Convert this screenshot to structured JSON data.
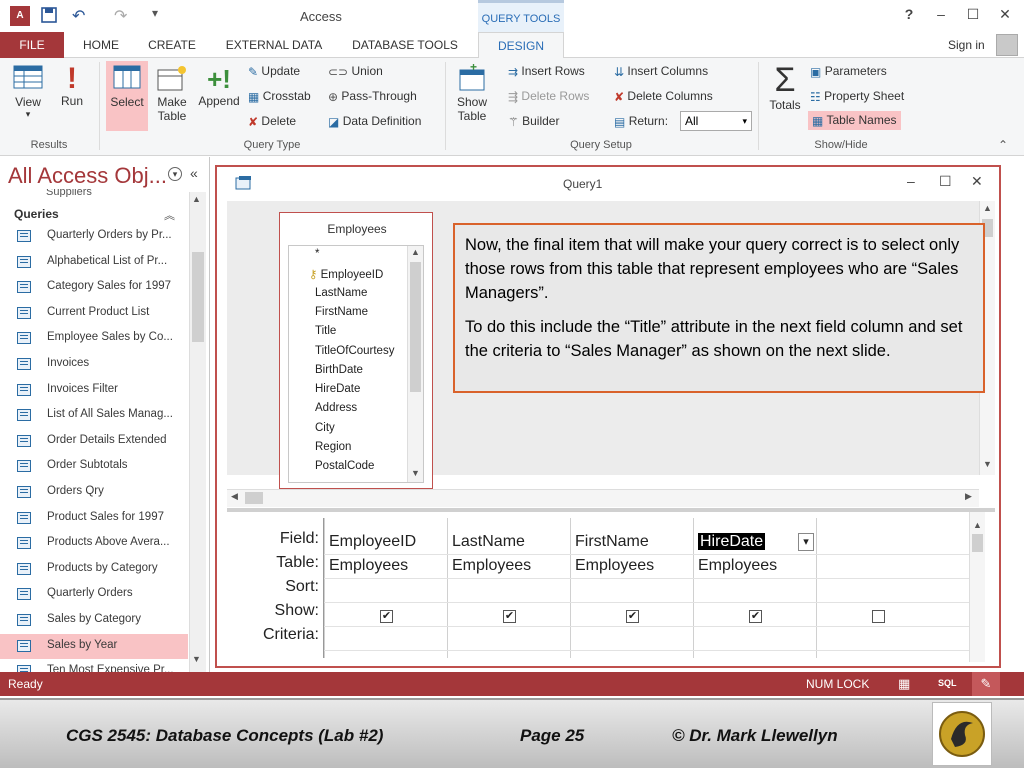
{
  "titlebar": {
    "title": "Access",
    "context_tab": "QUERY TOOLS",
    "help": "?",
    "minimize": "–",
    "maximize": "☐",
    "close": "✕"
  },
  "tabs": [
    {
      "label": "FILE"
    },
    {
      "label": "HOME"
    },
    {
      "label": "CREATE"
    },
    {
      "label": "EXTERNAL DATA"
    },
    {
      "label": "DATABASE TOOLS"
    },
    {
      "label": "DESIGN"
    }
  ],
  "signin": "Sign in",
  "ribbon": {
    "results": {
      "label": "Results",
      "view": "View",
      "run": "Run"
    },
    "query_type": {
      "label": "Query Type",
      "select": "Select",
      "make_table_1": "Make",
      "make_table_2": "Table",
      "append": "Append",
      "update": "Update",
      "crosstab": "Crosstab",
      "delete": "Delete",
      "union": "Union",
      "pass_through": "Pass-Through",
      "data_definition": "Data Definition"
    },
    "query_setup": {
      "label": "Query Setup",
      "show_table_1": "Show",
      "show_table_2": "Table",
      "insert_rows": "Insert Rows",
      "delete_rows": "Delete Rows",
      "builder": "Builder",
      "insert_columns": "Insert Columns",
      "delete_columns": "Delete Columns",
      "return_label": "Return:",
      "return_value": "All"
    },
    "show_hide": {
      "label": "Show/Hide",
      "totals": "Totals",
      "parameters": "Parameters",
      "property_sheet": "Property Sheet",
      "table_names": "Table Names"
    }
  },
  "nav": {
    "title": "All Access Obj...",
    "collapse": "«",
    "partial_top": "Suppliers",
    "section": "Queries",
    "items": [
      {
        "label": "Quarterly Orders by Pr..."
      },
      {
        "label": "Alphabetical List of Pr..."
      },
      {
        "label": "Category Sales for 1997"
      },
      {
        "label": "Current Product List"
      },
      {
        "label": "Employee Sales by Co..."
      },
      {
        "label": "Invoices"
      },
      {
        "label": "Invoices Filter"
      },
      {
        "label": "List of All Sales Manag..."
      },
      {
        "label": "Order Details Extended"
      },
      {
        "label": "Order Subtotals"
      },
      {
        "label": "Orders Qry"
      },
      {
        "label": "Product Sales for 1997"
      },
      {
        "label": "Products Above Avera..."
      },
      {
        "label": "Products by Category"
      },
      {
        "label": "Quarterly Orders"
      },
      {
        "label": "Sales by Category"
      },
      {
        "label": "Sales by Year"
      },
      {
        "label": "Ten Most Expensive Pr..."
      }
    ]
  },
  "query": {
    "title": "Query1",
    "table_box": {
      "name": "Employees",
      "fields": [
        "*",
        "EmployeeID",
        "LastName",
        "FirstName",
        "Title",
        "TitleOfCourtesy",
        "BirthDate",
        "HireDate",
        "Address",
        "City",
        "Region",
        "PostalCode"
      ]
    },
    "callout": {
      "p1": "Now, the final item that will make your query correct is to select only those rows from this table that represent employees who are “Sales Managers”.",
      "p2": "To do this include the “Title” attribute in the next field column and set the criteria to “Sales Manager” as shown on the next slide."
    },
    "grid": {
      "row_labels": {
        "field": "Field:",
        "table": "Table:",
        "sort": "Sort:",
        "show": "Show:",
        "criteria": "Criteria:"
      },
      "columns": [
        {
          "field": "EmployeeID",
          "table": "Employees",
          "show": "✔"
        },
        {
          "field": "LastName",
          "table": "Employees",
          "show": "✔"
        },
        {
          "field": "FirstName",
          "table": "Employees",
          "show": "✔"
        },
        {
          "field": "HireDate",
          "table": "Employees",
          "show": "✔"
        },
        {
          "field": "",
          "table": "",
          "show": ""
        }
      ]
    }
  },
  "status": {
    "left": "Ready",
    "numlock": "NUM LOCK",
    "sql": "SQL"
  },
  "footer": {
    "course": "CGS 2545: Database Concepts  (Lab #2)",
    "page": "Page 25",
    "author": "© Dr. Mark Llewellyn"
  },
  "colors": {
    "accent": "#a4373a",
    "highlight": "#f9c3c5",
    "callout_border": "#d9622b"
  }
}
